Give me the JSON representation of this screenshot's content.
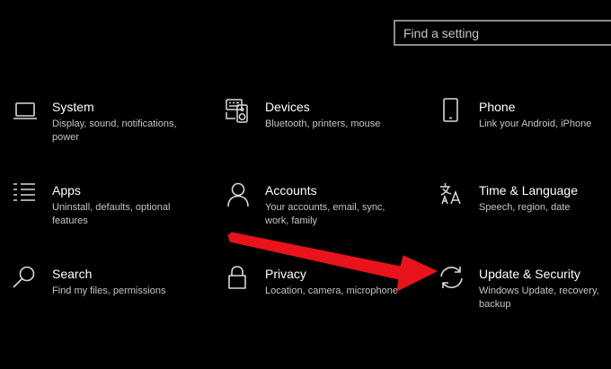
{
  "search": {
    "placeholder": "Find a setting"
  },
  "tiles": [
    {
      "icon": "laptop-icon",
      "label": "System",
      "description": "Display, sound, notifications, power"
    },
    {
      "icon": "keyboard-speaker-icon",
      "label": "Devices",
      "description": "Bluetooth, printers, mouse"
    },
    {
      "icon": "phone-icon",
      "label": "Phone",
      "description": "Link your Android, iPhone"
    },
    {
      "icon": "apps-list-icon",
      "label": "Apps",
      "description": "Uninstall, defaults, optional features"
    },
    {
      "icon": "person-icon",
      "label": "Accounts",
      "description": "Your accounts, email, sync, work, family"
    },
    {
      "icon": "language-icon",
      "label": "Time & Language",
      "description": "Speech, region, date"
    },
    {
      "icon": "search-icon",
      "label": "Search",
      "description": "Find my files, permissions"
    },
    {
      "icon": "lock-icon",
      "label": "Privacy",
      "description": "Location, camera, microphone"
    },
    {
      "icon": "sync-icon",
      "label": "Update & Security",
      "description": "Windows Update, recovery, backup"
    }
  ],
  "colors": {
    "background": "#000000",
    "text": "#ffffff",
    "description_text": "#c4c4c4",
    "icon_stroke": "#d8d8d8",
    "search_border": "#8a8a8a",
    "annotation_arrow": "#e8131b"
  }
}
